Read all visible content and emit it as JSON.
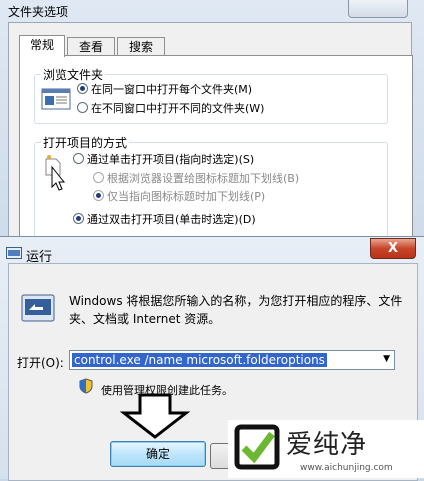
{
  "folder_options": {
    "title": "文件夹选项",
    "tabs": [
      {
        "label": "常规",
        "active": true
      },
      {
        "label": "查看",
        "active": false
      },
      {
        "label": "搜索",
        "active": false
      }
    ],
    "browse_group": {
      "label": "浏览文件夹",
      "options": [
        {
          "label": "在同一窗口中打开每个文件夹(M)",
          "selected": true
        },
        {
          "label": "在不同窗口中打开不同的文件夹(W)",
          "selected": false
        }
      ]
    },
    "open_group": {
      "label": "打开项目的方式",
      "options": [
        {
          "label": "通过单击打开项目(指向时选定)(S)",
          "selected": false,
          "enabled": true
        },
        {
          "label": "根据浏览器设置给图标标题加下划线(B)",
          "selected": false,
          "enabled": false
        },
        {
          "label": "仅当指向图标标题时加下划线(P)",
          "selected": true,
          "enabled": false
        },
        {
          "label": "通过双击打开项目(单击时选定)(D)",
          "selected": true,
          "enabled": true
        }
      ]
    }
  },
  "run_dialog": {
    "title": "运行",
    "close_label": "X",
    "description": "Windows 将根据您所输入的名称，为您打开相应的程序、文件夹、文档或 Internet 资源。",
    "open_label": "打开(O):",
    "command_value": "control.exe /name microsoft.folderoptions",
    "admin_text": "使用管理权限创建此任务。",
    "ok_label": "确定"
  },
  "watermark": {
    "text": "爱纯净",
    "url": "www.aichunjing.com"
  },
  "colors": {
    "selection": "#3366cc",
    "close_red": "#c7452a",
    "ok_blue": "#bee6fd"
  }
}
